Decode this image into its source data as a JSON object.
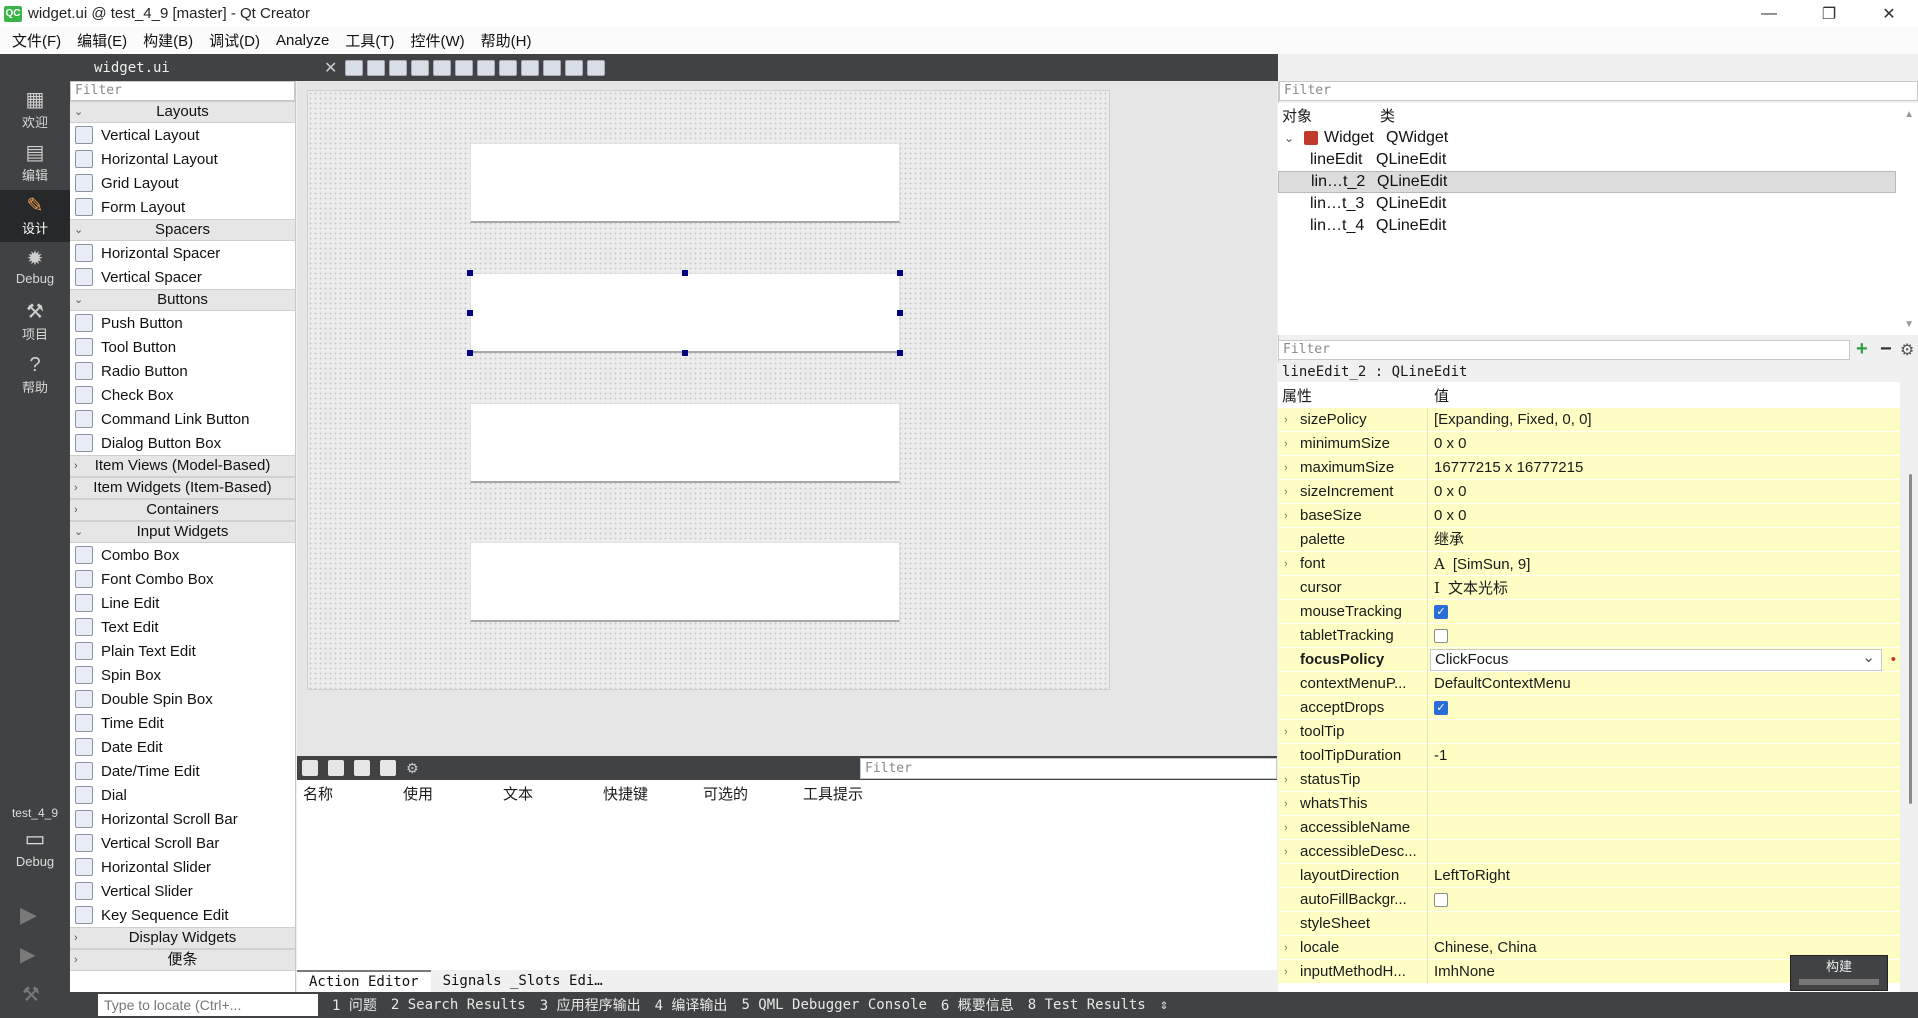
{
  "window": {
    "title": "widget.ui @ test_4_9 [master] - Qt Creator",
    "minimize": "—",
    "maximize": "❐",
    "close": "✕"
  },
  "menu": [
    "文件(F)",
    "编辑(E)",
    "构建(B)",
    "调试(D)",
    "Analyze",
    "工具(T)",
    "控件(W)",
    "帮助(H)"
  ],
  "modes": [
    {
      "label": "欢迎",
      "icon": "grid-icon"
    },
    {
      "label": "编辑",
      "icon": "document-icon"
    },
    {
      "label": "设计",
      "icon": "pencil-icon",
      "active": true
    },
    {
      "label": "Debug",
      "icon": "bug-icon"
    },
    {
      "label": "项目",
      "icon": "wrench-icon"
    },
    {
      "label": "帮助",
      "icon": "help-icon"
    }
  ],
  "kit": {
    "project": "test_4_9",
    "config": "Debug"
  },
  "toolbar": {
    "document": "widget.ui"
  },
  "widgetbox": {
    "filter_placeholder": "Filter",
    "sections": [
      {
        "title": "Layouts",
        "expanded": true,
        "items": [
          "Vertical Layout",
          "Horizontal Layout",
          "Grid Layout",
          "Form Layout"
        ]
      },
      {
        "title": "Spacers",
        "expanded": true,
        "items": [
          "Horizontal Spacer",
          "Vertical Spacer"
        ]
      },
      {
        "title": "Buttons",
        "expanded": true,
        "items": [
          "Push Button",
          "Tool Button",
          "Radio Button",
          "Check Box",
          "Command Link Button",
          "Dialog Button Box"
        ]
      },
      {
        "title": "Item Views (Model-Based)",
        "expanded": false,
        "items": []
      },
      {
        "title": "Item Widgets (Item-Based)",
        "expanded": false,
        "items": []
      },
      {
        "title": "Containers",
        "expanded": false,
        "items": []
      },
      {
        "title": "Input Widgets",
        "expanded": true,
        "items": [
          "Combo Box",
          "Font Combo Box",
          "Line Edit",
          "Text Edit",
          "Plain Text Edit",
          "Spin Box",
          "Double Spin Box",
          "Time Edit",
          "Date Edit",
          "Date/Time Edit",
          "Dial",
          "Horizontal Scroll Bar",
          "Vertical Scroll Bar",
          "Horizontal Slider",
          "Vertical Slider",
          "Key Sequence Edit"
        ]
      },
      {
        "title": "Display Widgets",
        "expanded": false,
        "items": []
      },
      {
        "title": "便条",
        "expanded": false,
        "items": []
      }
    ]
  },
  "action_editor": {
    "filter_placeholder": "Filter",
    "columns": [
      "名称",
      "使用",
      "文本",
      "快捷键",
      "可选的",
      "工具提示"
    ],
    "tabs": [
      "Action Editor",
      "Signals _Slots Edi…"
    ]
  },
  "object_inspector": {
    "filter_placeholder": "Filter",
    "columns": [
      "对象",
      "类"
    ],
    "rows": [
      {
        "object": "Widget",
        "class": "QWidget",
        "level": 0
      },
      {
        "object": "lineEdit",
        "class": "QLineEdit",
        "level": 1
      },
      {
        "object": "lin…t_2",
        "class": "QLineEdit",
        "level": 1,
        "selected": true
      },
      {
        "object": "lin…t_3",
        "class": "QLineEdit",
        "level": 1
      },
      {
        "object": "lin…t_4",
        "class": "QLineEdit",
        "level": 1
      }
    ]
  },
  "property_editor": {
    "filter_placeholder": "Filter",
    "class_label": "lineEdit_2 : QLineEdit",
    "columns": [
      "属性",
      "值"
    ],
    "rows": [
      {
        "name": "sizePolicy",
        "value": "[Expanding, Fixed, 0, 0]",
        "expand": true
      },
      {
        "name": "minimumSize",
        "value": "0 x 0",
        "expand": true
      },
      {
        "name": "maximumSize",
        "value": "16777215 x 16777215",
        "expand": true
      },
      {
        "name": "sizeIncrement",
        "value": "0 x 0",
        "expand": true
      },
      {
        "name": "baseSize",
        "value": "0 x 0",
        "expand": true
      },
      {
        "name": "palette",
        "value": "继承"
      },
      {
        "name": "font",
        "value": "[SimSun, 9]",
        "expand": true,
        "glyph": "A"
      },
      {
        "name": "cursor",
        "value": "文本光标",
        "glyph": "I"
      },
      {
        "name": "mouseTracking",
        "check": true
      },
      {
        "name": "tabletTracking",
        "check": false
      },
      {
        "name": "focusPolicy",
        "value": "ClickFocus",
        "bold": true,
        "combo": true
      },
      {
        "name": "contextMenuP...",
        "value": "DefaultContextMenu"
      },
      {
        "name": "acceptDrops",
        "check": true
      },
      {
        "name": "toolTip",
        "value": "",
        "expand": true
      },
      {
        "name": "toolTipDuration",
        "value": "-1"
      },
      {
        "name": "statusTip",
        "value": "",
        "expand": true
      },
      {
        "name": "whatsThis",
        "value": "",
        "expand": true
      },
      {
        "name": "accessibleName",
        "value": "",
        "expand": true
      },
      {
        "name": "accessibleDesc...",
        "value": "",
        "expand": true
      },
      {
        "name": "layoutDirection",
        "value": "LeftToRight"
      },
      {
        "name": "autoFillBackgr...",
        "check": false
      },
      {
        "name": "styleSheet",
        "value": ""
      },
      {
        "name": "locale",
        "value": "Chinese, China",
        "expand": true
      },
      {
        "name": "inputMethodH...",
        "value": "ImhNone",
        "expand": true
      }
    ]
  },
  "statusbar": {
    "locator_placeholder": "Type to locate (Ctrl+...",
    "outputs": [
      "1 问题",
      "2 Search Results",
      "3 应用程序输出",
      "4 编译输出",
      "5 QML Debugger Console",
      "6 概要信息",
      "8 Test Results"
    ],
    "build_popup": "构建"
  },
  "colors": {
    "sidebar": "#404244",
    "property_row": "#fefec4",
    "selection_handle": "#000080",
    "check_on": "#2b6cd8"
  }
}
